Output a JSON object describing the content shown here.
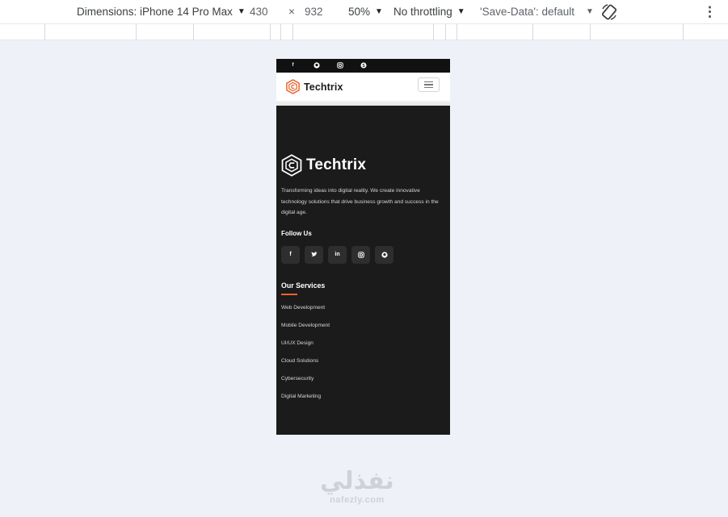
{
  "devtools": {
    "dimensions_label": "Dimensions: iPhone 14 Pro Max",
    "width": "430",
    "times": "×",
    "height": "932",
    "zoom": "50%",
    "throttling": "No throttling",
    "save_data": "'Save-Data': default",
    "more": "⋮"
  },
  "site": {
    "brand": "Techtrix",
    "topbar_icons": [
      "facebook-icon",
      "github-icon",
      "instagram-icon",
      "skype-icon"
    ],
    "footer": {
      "brand": "Techtrix",
      "description": "Transforming ideas into digital reality. We create innovative technology solutions that drive business growth and success in the digital age.",
      "follow_heading": "Follow Us",
      "social_icons": [
        "facebook-icon",
        "twitter-icon",
        "linkedin-icon",
        "instagram-icon",
        "github-icon"
      ],
      "services_heading": "Our Services",
      "services": [
        "Web Development",
        "Mobile Development",
        "UI/UX Design",
        "Cloud Solutions",
        "Cybersecurity",
        "Digital Marketing"
      ]
    }
  },
  "watermark": {
    "arabic": "نفذلي",
    "latin": "nafezly.com"
  },
  "colors": {
    "accent": "#e8662d",
    "footer_bg": "#1b1b1b",
    "page_bg": "#eef1f8"
  }
}
